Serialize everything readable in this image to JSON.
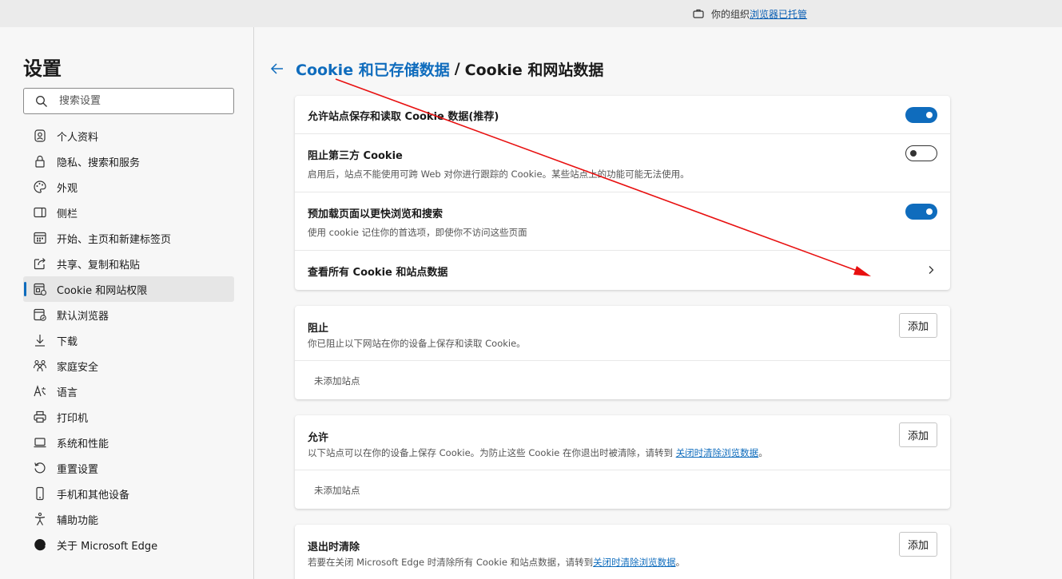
{
  "topbar": {
    "managed_prefix": "你的组织",
    "managed_link": "浏览器已托管"
  },
  "sidebar": {
    "title": "设置",
    "search_placeholder": "搜索设置",
    "items": [
      {
        "label": "个人资料",
        "icon": "profile-icon"
      },
      {
        "label": "隐私、搜索和服务",
        "icon": "lock-icon"
      },
      {
        "label": "外观",
        "icon": "palette-icon"
      },
      {
        "label": "侧栏",
        "icon": "sidebar-icon"
      },
      {
        "label": "开始、主页和新建标签页",
        "icon": "home-grid-icon"
      },
      {
        "label": "共享、复制和粘贴",
        "icon": "share-icon"
      },
      {
        "label": "Cookie 和网站权限",
        "icon": "cookie-site-icon",
        "active": true
      },
      {
        "label": "默认浏览器",
        "icon": "browser-icon"
      },
      {
        "label": "下载",
        "icon": "download-icon"
      },
      {
        "label": "家庭安全",
        "icon": "family-icon"
      },
      {
        "label": "语言",
        "icon": "language-icon"
      },
      {
        "label": "打印机",
        "icon": "printer-icon"
      },
      {
        "label": "系统和性能",
        "icon": "laptop-icon"
      },
      {
        "label": "重置设置",
        "icon": "reset-icon"
      },
      {
        "label": "手机和其他设备",
        "icon": "phone-icon"
      },
      {
        "label": "辅助功能",
        "icon": "accessibility-icon"
      },
      {
        "label": "关于 Microsoft Edge",
        "icon": "edge-logo-icon"
      }
    ]
  },
  "breadcrumb": {
    "parent": "Cookie 和已存储数据",
    "separator": "/",
    "current": "Cookie 和网站数据"
  },
  "settings": {
    "allow_cookies": {
      "title": "允许站点保存和读取 Cookie 数据(推荐)",
      "enabled": true
    },
    "block_third_party": {
      "title": "阻止第三方 Cookie",
      "desc": "启用后，站点不能使用可跨 Web 对你进行跟踪的 Cookie。某些站点上的功能可能无法使用。",
      "enabled": false
    },
    "preload": {
      "title": "预加载页面以更快浏览和搜索",
      "desc": "使用 cookie 记住你的首选项，即使你不访问这些页面",
      "enabled": true
    },
    "view_all": {
      "title": "查看所有 Cookie 和站点数据"
    }
  },
  "block_section": {
    "title": "阻止",
    "desc": "你已阻止以下网站在你的设备上保存和读取 Cookie。",
    "add_label": "添加",
    "empty": "未添加站点"
  },
  "allow_section": {
    "title": "允许",
    "desc_prefix": "以下站点可以在你的设备上保存 Cookie。为防止这些 Cookie 在你退出时被清除，请转到 ",
    "desc_link": "关闭时清除浏览数据",
    "desc_suffix": "。",
    "add_label": "添加",
    "empty": "未添加站点"
  },
  "clear_section": {
    "title": "退出时清除",
    "desc_prefix": "若要在关闭 Microsoft Edge 时清除所有 Cookie 和站点数据，请转到",
    "desc_link": "关闭时清除浏览数据",
    "desc_suffix": "。",
    "add_label": "添加"
  },
  "colors": {
    "accent": "#0f6cbd",
    "annotation_arrow": "#e81010"
  }
}
